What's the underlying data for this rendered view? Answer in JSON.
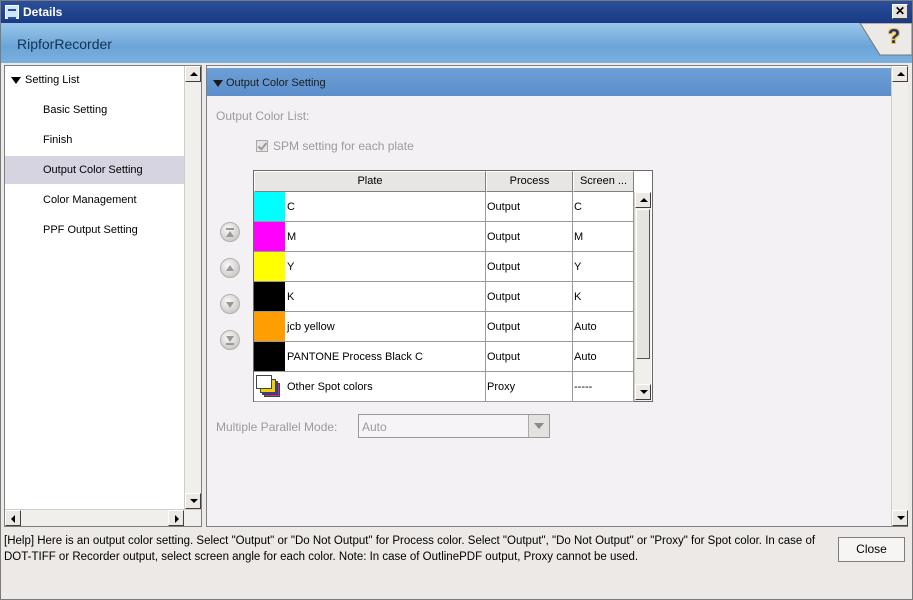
{
  "window": {
    "title": "Details",
    "app_name": "RipforRecorder",
    "close_glyph": "✕",
    "help_glyph": "?"
  },
  "sidebar": {
    "header": "Setting List",
    "items": [
      {
        "label": "Basic Setting",
        "selected": false
      },
      {
        "label": "Finish",
        "selected": false
      },
      {
        "label": "Output Color Setting",
        "selected": true
      },
      {
        "label": "Color Management",
        "selected": false
      },
      {
        "label": "PPF Output Setting",
        "selected": false
      }
    ]
  },
  "main": {
    "section_title": "Output Color Setting",
    "output_color_list_label": "Output Color List:",
    "spm_label": "SPM setting for each plate",
    "spm_checked": true,
    "table": {
      "headers": [
        "Plate",
        "Process",
        "Screen ..."
      ],
      "rows": [
        {
          "plate": "C",
          "process": "Output",
          "screen": "C",
          "color": "#00ffff"
        },
        {
          "plate": "M",
          "process": "Output",
          "screen": "M",
          "color": "#ff00ff"
        },
        {
          "plate": "Y",
          "process": "Output",
          "screen": "Y",
          "color": "#ffff00"
        },
        {
          "plate": "K",
          "process": "Output",
          "screen": "K",
          "color": "#000000"
        },
        {
          "plate": "jcb yellow",
          "process": "Output",
          "screen": "Auto",
          "color": "#ff9e00"
        },
        {
          "plate": "PANTONE Process Black C",
          "process": "Output",
          "screen": "Auto",
          "color": "#000000"
        },
        {
          "plate": "Other Spot colors",
          "process": "Proxy",
          "screen": "-----",
          "color": "multi"
        }
      ]
    },
    "multiple_parallel_label": "Multiple Parallel Mode:",
    "multiple_parallel_value": "Auto"
  },
  "footer": {
    "help_text": "[Help] Here is an output color setting. Select \"Output\" or \"Do Not Output\" for Process color. Select \"Output\", \"Do Not Output\" or \"Proxy\" for Spot color. In case of DOT-TIFF or Recorder output, select screen angle for each color.  Note: In case of OutlinePDF output, Proxy cannot be used.",
    "close_label": "Close"
  }
}
